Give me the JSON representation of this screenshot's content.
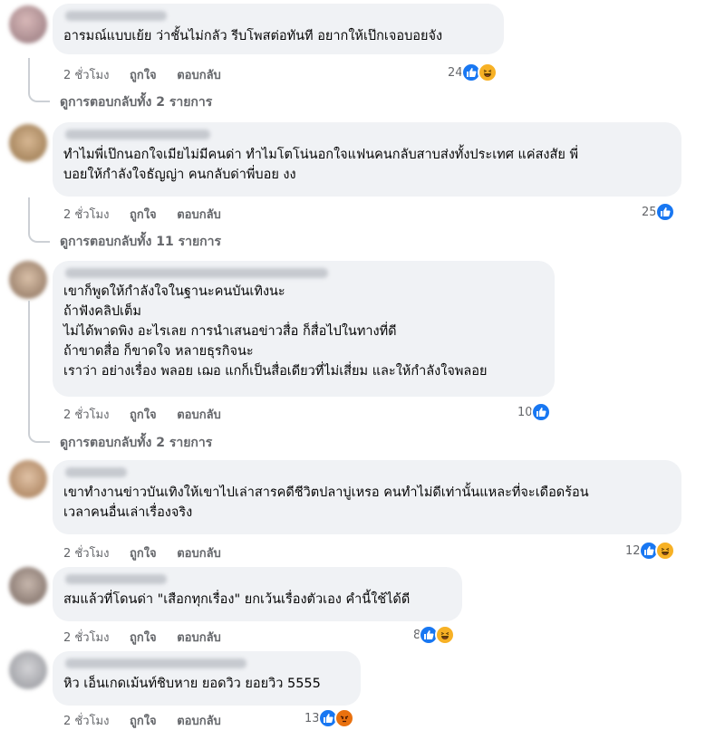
{
  "actions": {
    "like_label": "ถูกใจ",
    "reply_label": "ตอบกลับ"
  },
  "comments": [
    {
      "lines": [
        "อารมณ์แบบเย้ย ว่าชั้นไม่กลัว รีบโพสต่อทันที อยากให้เป๊กเจอบอยจัง"
      ],
      "time": "2 ชั่วโมง",
      "reaction_count": "24",
      "reactions": [
        "like-icon",
        "haha-icon"
      ],
      "view_replies": "ดูการตอบกลับทั้ง 2 รายการ"
    },
    {
      "lines": [
        "ทำไมพี่เป๊กนอกใจเมียไม่มีคนด่า ทำไมโตโน่นอกใจแฟนคนกลับสาบส่งทั้งประเทศ แค่สงสัย พี่",
        "บอยให้กำลังใจธัญญ่า คนกลับด่าพี่บอย งง"
      ],
      "time": "2 ชั่วโมง",
      "reaction_count": "25",
      "reactions": [
        "like-icon"
      ],
      "view_replies": "ดูการตอบกลับทั้ง 11 รายการ"
    },
    {
      "lines": [
        "เขาก็พูดให้กำลังใจในฐานะคนบันเทิงนะ",
        "ถ้าฟังคลิปเต็ม",
        "ไม่ได้พาดพิง อะไรเลย การนำเสนอข่าวสื่อ ก็สื่อไปในทางที่ดี",
        "ถ้าขาดสื่อ ก็ขาดใจ หลายธุรกิจนะ",
        "เราว่า อย่างเรื่อง พลอย เฌอ แกก็เป็นสื่อเดียวที่ไม่เสี่ยม และให้กำลังใจพลอย"
      ],
      "time": "2 ชั่วโมง",
      "reaction_count": "10",
      "reactions": [
        "like-icon"
      ],
      "view_replies": "ดูการตอบกลับทั้ง 2 รายการ"
    },
    {
      "lines": [
        "เขาทำงานข่าวบันเทิงให้เขาไปเล่าสารคดีชีวิตปลาบู่เหรอ คนทำไม่ดีเท่านั้นแหละที่จะเดือดร้อน",
        "เวลาคนอื่นเล่าเรื่องจริง"
      ],
      "time": "2 ชั่วโมง",
      "reaction_count": "12",
      "reactions": [
        "like-icon",
        "haha-icon"
      ],
      "view_replies": ""
    },
    {
      "lines": [
        "สมแล้วที่โดนด่า \"เสือกทุกเรื่อง\" ยกเว้นเรื่องตัวเอง คำนี้ใช้ได้ดี"
      ],
      "time": "2 ชั่วโมง",
      "reaction_count": "8",
      "reactions": [
        "like-icon",
        "haha-icon"
      ],
      "view_replies": ""
    },
    {
      "lines": [
        "หิว เอ็นเกดเม้นท์ชิบหาย ยอดวิว ยอยวิว 5555"
      ],
      "time": "2 ชั่วโมง",
      "reaction_count": "13",
      "reactions": [
        "like-icon",
        "angry-icon"
      ],
      "view_replies": ""
    }
  ],
  "colors": {
    "bubble": "#f0f2f5",
    "secondary_text": "#65676b",
    "like_blue": "#1877f2",
    "haha_yellow": "#f7b125",
    "angry_orange": "#e9710f"
  }
}
